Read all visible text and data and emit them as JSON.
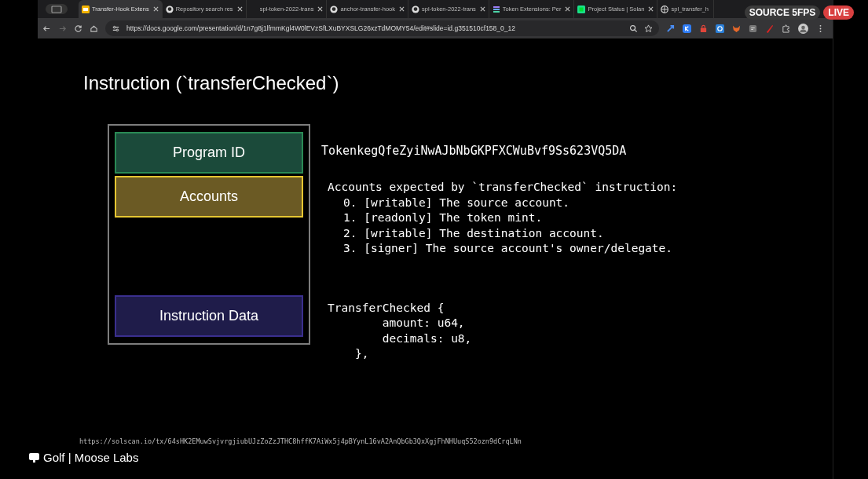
{
  "browser": {
    "tabs": [
      {
        "title": "Transfer-Hook Extens",
        "kind": "slides",
        "selected": true
      },
      {
        "title": "Repository search res",
        "kind": "github",
        "selected": false
      },
      {
        "title": "spl-token-2022-trans",
        "kind": "blank",
        "selected": false
      },
      {
        "title": "anchor-transfer-hook",
        "kind": "github",
        "selected": false
      },
      {
        "title": "spl-token-2022-trans",
        "kind": "github",
        "selected": false
      },
      {
        "title": "Token Extensions: Per",
        "kind": "stack",
        "selected": false
      },
      {
        "title": "Project Status | Solan",
        "kind": "sheet",
        "selected": false
      },
      {
        "title": "spl_transfer_h",
        "kind": "globe",
        "selected": false
      }
    ],
    "url": "https://docs.google.com/presentation/d/1n7g8j1lfmmKgl4W0lEVzSfLXuBYXSLG26xzTdMOMY54/edit#slide=id.g351510cf158_0_12"
  },
  "stream_badges": {
    "source": "SOURCE 5FPS",
    "live": "LIVE"
  },
  "slide": {
    "title": "Instruction (`transferChecked`)",
    "blocks": [
      {
        "label": "Program ID",
        "kind": "program"
      },
      {
        "label": "Accounts",
        "kind": "accounts"
      },
      {
        "label": "Instruction Data",
        "kind": "data"
      }
    ],
    "program_id": "TokenkegQfeZyiNwAJbNbGKPFXCWuBvf9Ss623VQ5DA",
    "accounts_heading": "Accounts expected by `transferChecked` instruction:",
    "accounts": [
      "0. [writable] The source account.",
      "1. [readonly] The token mint.",
      "2. [writable] The destination account.",
      "3. [signer] The source account's owner/delegate."
    ],
    "code": [
      "TransferChecked {",
      "        amount: u64,",
      "        decimals: u8,",
      "    },"
    ]
  },
  "overlay": {
    "channel": "Golf | Moose Labs",
    "link": "https://solscan.io/tx/64sHK2EMuwSvjvrgjiubUJzZoZzJTHC8hffK7AiWx5j4pBYynL16vA2AnQbGb3QxXgjFhNHUuqS52ozn9dCrqLNn"
  }
}
